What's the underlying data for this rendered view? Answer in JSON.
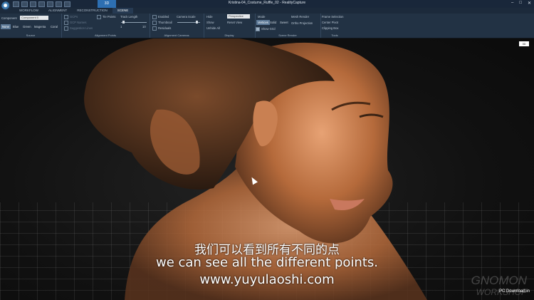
{
  "window": {
    "title": "Kristina-04_Costume_Ruffle_02 - RealityCapture",
    "mode_tab": "3D"
  },
  "tabs": [
    "WORKFLOW",
    "ALIGNMENT",
    "RECONSTRUCTION",
    "SCENE"
  ],
  "source": {
    "component_label": "Component",
    "component_value": "Component 0",
    "colors": [
      "None",
      "Blue",
      "Green",
      "Magenta",
      "Coral"
    ],
    "group_label": "Source"
  },
  "alignment_points": {
    "items": [
      "GCPs",
      "GCP Names",
      "Suggestion Lines"
    ],
    "tie_points": "Tie Points",
    "track_length": "Track Length",
    "slider_min": "1",
    "slider_max": "10",
    "group_label": "Alignment Points"
  },
  "alignment_cameras": {
    "items": [
      "Enabled",
      "Thumbnail",
      "Residuals"
    ],
    "camera_scale": "Camera Scale",
    "group_label": "Alignment Cameras"
  },
  "display": {
    "hide": "Hide",
    "show": "Show",
    "unhide_all": "Unhide All",
    "projection": "Perspective",
    "reset_view": "Reset View",
    "group_label": "Display"
  },
  "scene_render": {
    "mode_label": "Mode",
    "modes": [
      "Vertices",
      "Solid",
      "Sweet"
    ],
    "show_grid": "Show Grid",
    "mesh_render": "Mesh Render",
    "ortho": "Ortho Projection",
    "group_label": "Scene Render"
  },
  "tools": {
    "items": [
      "Frame Selection",
      "Center Pivot",
      "Clipping Box"
    ],
    "group_label": "Tools"
  },
  "viewport": {
    "axis_badge": "3D"
  },
  "subtitles": {
    "cn": "我们可以看到所有不同的点",
    "en": "we can see all the different points.",
    "url": "www.yuyulaoshi.com"
  },
  "watermark": {
    "line1": "GNOMON",
    "line2": "WORKSHOP",
    "pc": "PC Download.in"
  },
  "colors": {
    "ribbon": "#223244",
    "title_bar": "#19273a",
    "accent": "#2d6fb2"
  }
}
